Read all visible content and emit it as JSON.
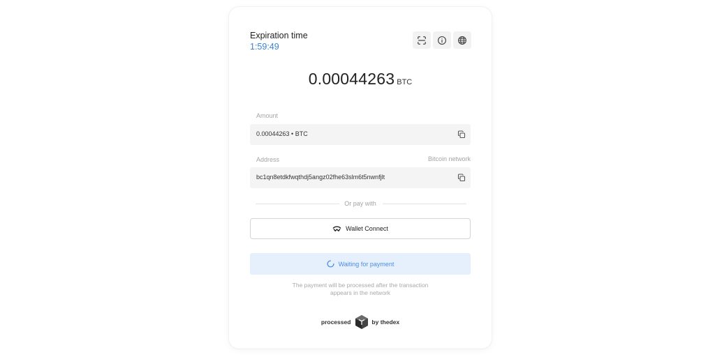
{
  "header": {
    "expiration_label": "Expiration time",
    "expiration_time": "1:59:49",
    "icons": [
      "scan-icon",
      "info-icon",
      "globe-icon"
    ]
  },
  "payment": {
    "amount": "0.00044263",
    "currency": "BTC"
  },
  "amount_field": {
    "label": "Amount",
    "value": "0.00044263 • BTC"
  },
  "address_field": {
    "label": "Address",
    "network": "Bitcoin network",
    "value": "bc1qn8etdkfwqthdj5angz02fhe63slm6t5nwnfjlt"
  },
  "divider": {
    "text": "Or pay with"
  },
  "wallet_connect": {
    "label": "Wallet Connect"
  },
  "status": {
    "label": "Waiting for payment"
  },
  "note": {
    "line1": "The payment will be processed after the transaction",
    "line2": "appears in the network"
  },
  "footer": {
    "left": "processed",
    "right": "by thedex"
  },
  "colors": {
    "accent": "#3b82d6",
    "status_bg": "#e6f0fc",
    "status_text": "#4a8ee0",
    "field_bg": "#f4f4f4"
  }
}
